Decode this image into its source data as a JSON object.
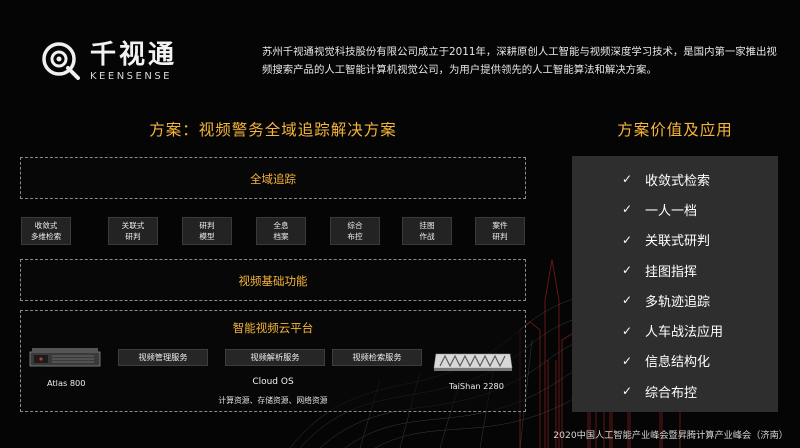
{
  "logo": {
    "name_cn": "千视通",
    "name_en": "KEENSENSE"
  },
  "intro": "苏州千视通视觉科技股份有限公司成立于2011年，深耕原创人工智能与视频深度学习技术，是国内第一家推出视频搜索产品的人工智能计算机视觉公司，为用户提供领先的人工智能算法和解决方案。",
  "solution_title": "方案：视频警务全域追踪解决方案",
  "global_tracking": "全域追踪",
  "functions": [
    "收敛式\n多维检索",
    "关联式\n研判",
    "研判\n模型",
    "全息\n档案",
    "综合\n布控",
    "挂图\n作战",
    "案件\n研判"
  ],
  "basic_functions": "视频基础功能",
  "cloud_platform": {
    "title": "智能视频云平台",
    "services": [
      "视频管理服务",
      "视频解析服务",
      "视频检索服务"
    ],
    "os": "Cloud OS",
    "resources": "计算资源、存储资源、网络资源",
    "server_left": "Atlas 800",
    "server_right": "TaiShan 2280"
  },
  "value_title": "方案价值及应用",
  "values": [
    "收敛式检索",
    "一人一档",
    "关联式研判",
    "挂图指挥",
    "多轨迹追踪",
    "人车战法应用",
    "信息结构化",
    "综合布控"
  ],
  "footer": "2020中国人工智能产业峰会暨昇腾计算产业峰会（济南）",
  "colors": {
    "accent": "#f5b43a",
    "background": "#050505",
    "panel": "#2e2e2e"
  }
}
